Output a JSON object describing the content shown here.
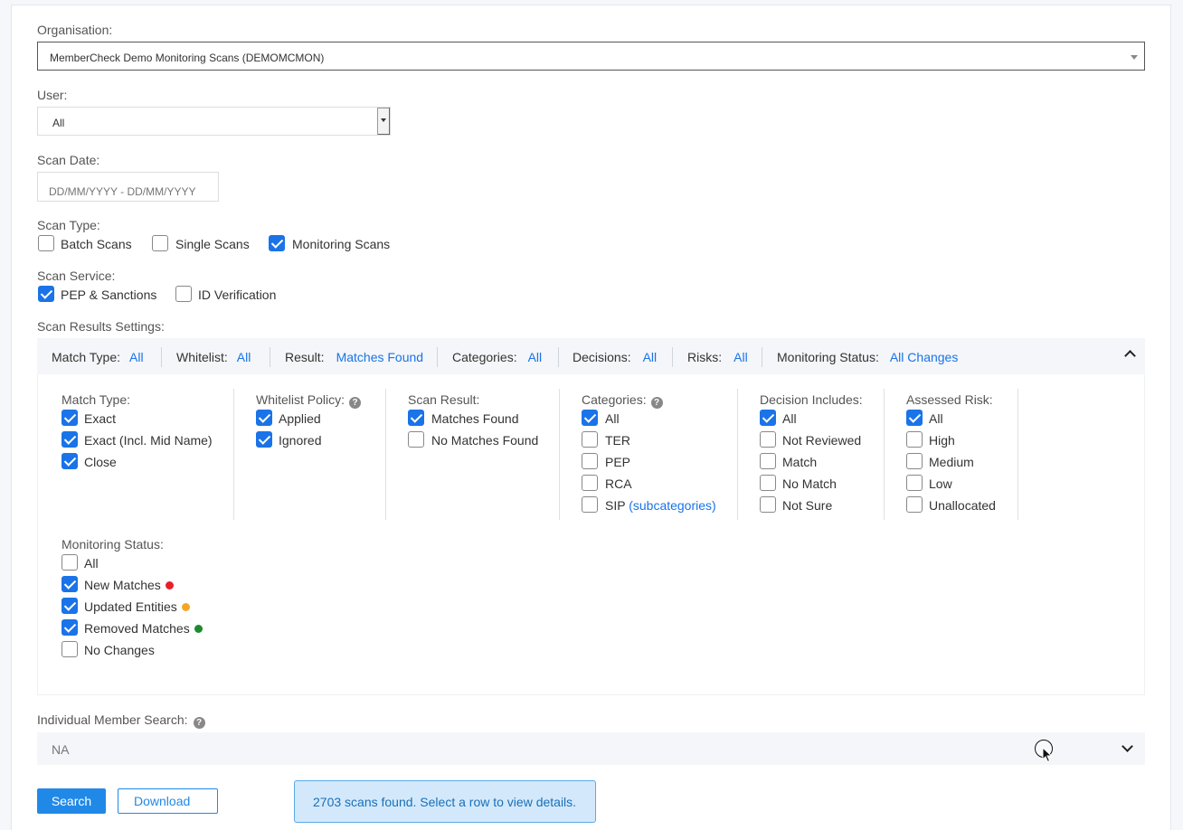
{
  "organisation": {
    "label": "Organisation:",
    "value": "MemberCheck Demo Monitoring Scans (DEMOMCMON)"
  },
  "user": {
    "label": "User:",
    "value": "All"
  },
  "scan_date": {
    "label": "Scan Date:",
    "placeholder": "DD/MM/YYYY - DD/MM/YYYY"
  },
  "scan_type": {
    "label": "Scan Type:",
    "options": [
      {
        "label": "Batch Scans",
        "checked": false
      },
      {
        "label": "Single Scans",
        "checked": false
      },
      {
        "label": "Monitoring Scans",
        "checked": true
      }
    ]
  },
  "scan_service": {
    "label": "Scan Service:",
    "options": [
      {
        "label": "PEP & Sanctions",
        "checked": true
      },
      {
        "label": "ID Verification",
        "checked": false
      }
    ]
  },
  "scan_results_settings": {
    "label": "Scan Results Settings:",
    "summary": [
      {
        "key": "Match Type:",
        "value": "All"
      },
      {
        "key": "Whitelist:",
        "value": "All"
      },
      {
        "key": "Result:",
        "value": "Matches Found"
      },
      {
        "key": "Categories:",
        "value": "All"
      },
      {
        "key": "Decisions:",
        "value": "All"
      },
      {
        "key": "Risks:",
        "value": "All"
      },
      {
        "key": "Monitoring Status:",
        "value": "All Changes"
      }
    ]
  },
  "groups": {
    "match_type": {
      "title": "Match Type:",
      "items": [
        {
          "label": "Exact",
          "checked": true
        },
        {
          "label": "Exact (Incl. Mid Name)",
          "checked": true
        },
        {
          "label": "Close",
          "checked": true
        }
      ]
    },
    "whitelist_policy": {
      "title": "Whitelist Policy:",
      "help": "?",
      "items": [
        {
          "label": "Applied",
          "checked": true
        },
        {
          "label": "Ignored",
          "checked": true
        }
      ]
    },
    "scan_result": {
      "title": "Scan Result:",
      "items": [
        {
          "label": "Matches Found",
          "checked": true
        },
        {
          "label": "No Matches Found",
          "checked": false
        }
      ]
    },
    "categories": {
      "title": "Categories:",
      "help": "?",
      "items": [
        {
          "label": "All",
          "checked": true
        },
        {
          "label": "TER",
          "checked": false
        },
        {
          "label": "PEP",
          "checked": false
        },
        {
          "label": "RCA",
          "checked": false
        },
        {
          "label": "SIP",
          "checked": false,
          "link": "(subcategories)"
        }
      ]
    },
    "decision_includes": {
      "title": "Decision Includes:",
      "items": [
        {
          "label": "All",
          "checked": true
        },
        {
          "label": "Not Reviewed",
          "checked": false
        },
        {
          "label": "Match",
          "checked": false
        },
        {
          "label": "No Match",
          "checked": false
        },
        {
          "label": "Not Sure",
          "checked": false
        }
      ]
    },
    "assessed_risk": {
      "title": "Assessed Risk:",
      "items": [
        {
          "label": "All",
          "checked": true
        },
        {
          "label": "High",
          "checked": false
        },
        {
          "label": "Medium",
          "checked": false
        },
        {
          "label": "Low",
          "checked": false
        },
        {
          "label": "Unallocated",
          "checked": false
        }
      ]
    },
    "monitoring_status": {
      "title": "Monitoring Status:",
      "items": [
        {
          "label": "All",
          "checked": false
        },
        {
          "label": "New Matches",
          "checked": true,
          "dot": "#e8202a"
        },
        {
          "label": "Updated Entities",
          "checked": true,
          "dot": "#f5a623"
        },
        {
          "label": "Removed Matches",
          "checked": true,
          "dot": "#1e8a2e"
        },
        {
          "label": "No Changes",
          "checked": false
        }
      ]
    }
  },
  "member_search": {
    "label": "Individual Member Search:",
    "help": "?",
    "value": "NA"
  },
  "actions": {
    "search_label": "Search",
    "download_label": "Download"
  },
  "info_message": "2703 scans found. Select a row to view details.",
  "colors": {
    "accent": "#1a73e8",
    "info_bg": "#d3e9fb"
  }
}
